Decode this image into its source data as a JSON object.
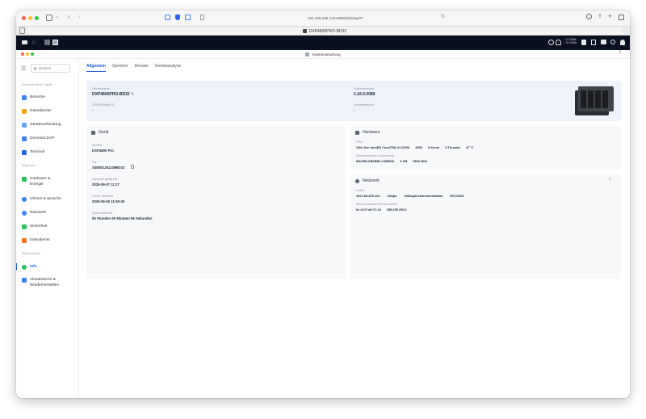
{
  "browser": {
    "url": "192.168.255.123:9999/desktop/#/",
    "tab_title": "DXP4800PRO-BD32"
  },
  "nas_bar": {
    "net_up": "↑ 2.7 KB/s",
    "net_down": "↓ 11.3 KB/s"
  },
  "app": {
    "title": "Systemsteuerung",
    "search_placeholder": "Suchen"
  },
  "sidebar": {
    "groups": [
      {
        "heading": "Konnektivität & Zugriff",
        "items": [
          {
            "label": "Benutzer",
            "color": "#3b82f6"
          },
          {
            "label": "Dateidienste",
            "color": "#f59e0b"
          },
          {
            "label": "Geräteverbindung",
            "color": "#60a5fa"
          },
          {
            "label": "Domain/LDAP",
            "color": "#3b82f6"
          },
          {
            "label": "Terminal",
            "color": "#2563eb"
          }
        ]
      },
      {
        "heading": "Allgemein",
        "items": [
          {
            "label": "Hardware & Energie",
            "color": "#22c55e"
          },
          {
            "label": "Uhrzeit & Sprache",
            "color": "#3b82f6"
          },
          {
            "label": "Netzwerk",
            "color": "#3b82f6"
          },
          {
            "label": "Sicherheit",
            "color": "#22c55e"
          },
          {
            "label": "Indexdienst",
            "color": "#f97316"
          }
        ]
      },
      {
        "heading": "Systemdienst",
        "items": [
          {
            "label": "Info",
            "color": "#22c55e",
            "active": true
          },
          {
            "label": "Aktualisieren & Wiederherstellen",
            "color": "#3b82f6"
          }
        ]
      }
    ]
  },
  "tabs": [
    "Allgemein",
    "Speicher",
    "Dienste",
    "Geräteanalyse"
  ],
  "active_tab": "Allgemein",
  "hero": {
    "device_name_label": "Gerätename",
    "device_name": "DXP4800PRO-BD32",
    "ugreen_id_label": "UGREENlink ID",
    "ugreen_id": "-",
    "system_version_label": "Systemversion",
    "system_version": "1.16.0.0089",
    "owner_label": "Gerätebesitzer",
    "owner": "-"
  },
  "device_card": {
    "title": "Gerät",
    "model_label": "Modell",
    "model": "DXP4800 Pro",
    "sn_label": "SN",
    "sn": "X4800ZJ61239BD32",
    "warranty_label": "Garantie gültig bis",
    "warranty": "2026-06-07 11:27",
    "last_start_label": "Letzte Startzeit",
    "last_start": "2026-06-06 11:55:49",
    "uptime_label": "Systemlaufzeit",
    "uptime": "05 Stunden 50 Minuten 56 Sekunden"
  },
  "hardware_card": {
    "title": "Hardware",
    "cpu_label": "CPU",
    "cpu_values": [
      "13th Gen Intel(R) Core(TM) i3-1315U",
      "4500",
      "6 Kerne",
      "8 Threads",
      "47 °C"
    ],
    "ram_label": "Arbeitsspeicher (Samsung)",
    "ram_values": [
      "M425R1GB4BB0-CWMOD",
      "8 GB",
      "5600 MHz"
    ]
  },
  "network_card": {
    "title": "Netzwerk",
    "lan_label": "LAN2",
    "lan_values": [
      "192.168.255.123",
      "1Gbps",
      "Vollduplexkommunikation",
      "MTU1500"
    ],
    "mac_label": "MAC-Adresse/Subnetzmaske",
    "mac_values": [
      "6c:1f:f7:a9:71:18",
      "255.255.255.0"
    ]
  }
}
